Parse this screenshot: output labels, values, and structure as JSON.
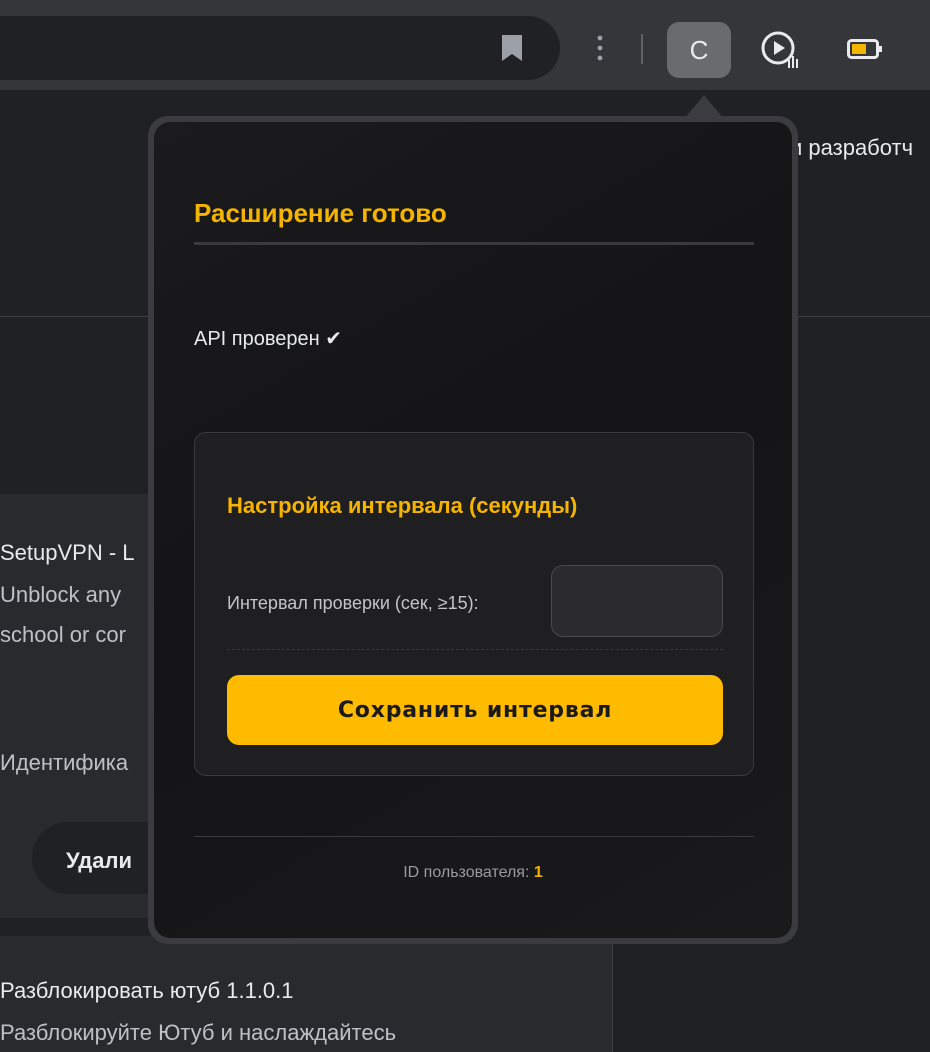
{
  "toolbar": {
    "extension_letter": "C",
    "icons": [
      "bookmark-icon",
      "menu-icon",
      "extension-c-button",
      "media-player-icon",
      "battery-icon"
    ]
  },
  "background": {
    "top_right_text": "и разработч",
    "card1": {
      "title": "SetupVPN - L",
      "desc_line1": "Unblock any",
      "desc_line2": "school or cor",
      "id_label": "Идентифика",
      "remove_label": "Удали"
    },
    "card2": {
      "title": "Разблокировать ютуб  1.1.0.1",
      "desc": "Разблокируйте Ютуб и наслаждайтесь"
    }
  },
  "popup": {
    "title": "Расширение готово",
    "status": "API проверен ✔",
    "settings": {
      "title": "Настройка интервала (секунды)",
      "interval_label": "Интервал проверки (сек, ≥15):",
      "interval_value": "",
      "save_label": "Сохранить интервал"
    },
    "footer": {
      "user_id_label": "ID пользователя:",
      "user_id_value": "1"
    }
  },
  "colors": {
    "accent": "#ffbb00",
    "title": "#f5b400",
    "popup_bg": "#151517"
  }
}
